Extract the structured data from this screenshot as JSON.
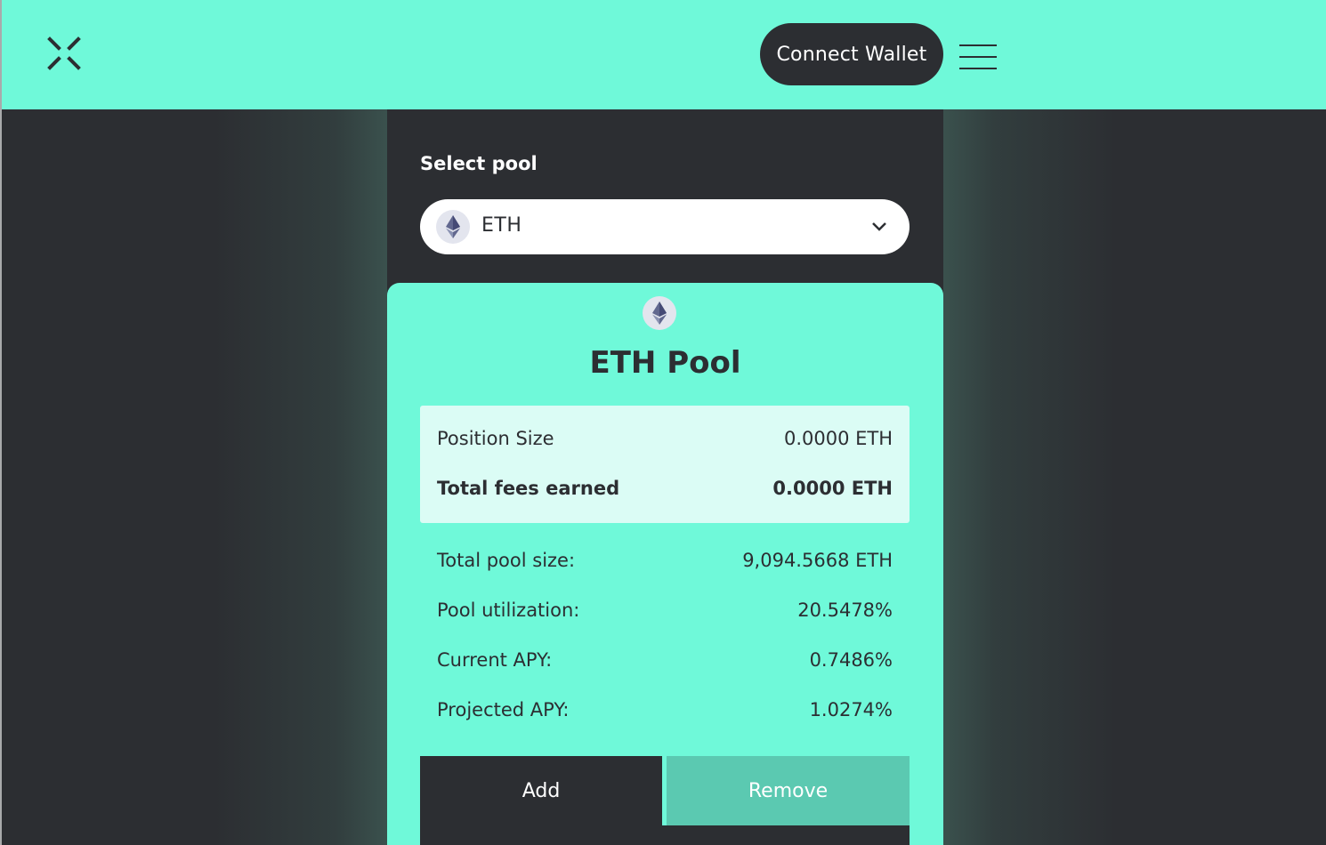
{
  "header": {
    "logo_icon": "x-logo-icon",
    "connect_label": "Connect Wallet",
    "menu_icon": "hamburger-menu-icon"
  },
  "pool_selector": {
    "label": "Select pool",
    "selected": "ETH",
    "token_icon": "eth-icon",
    "dropdown_icon": "chevron-down-icon"
  },
  "pool_card": {
    "title": "ETH Pool",
    "token_icon": "eth-icon",
    "position": {
      "size_label": "Position Size",
      "size_value": "0.0000 ETH",
      "fees_label": "Total fees earned",
      "fees_value": "0.0000 ETH"
    },
    "stats": [
      {
        "label": "Total pool size:",
        "value": "9,094.5668 ETH"
      },
      {
        "label": "Pool utilization:",
        "value": "20.5478%"
      },
      {
        "label": "Current APY:",
        "value": "0.7486%"
      },
      {
        "label": "Projected APY:",
        "value": "1.0274%"
      }
    ],
    "tabs": {
      "add": "Add",
      "remove": "Remove",
      "active": "Add"
    }
  },
  "colors": {
    "accent": "#6ff9d9",
    "dark": "#2c2e32",
    "tab_inactive": "#5bc9b1",
    "position_box": "#dbfcf5"
  }
}
